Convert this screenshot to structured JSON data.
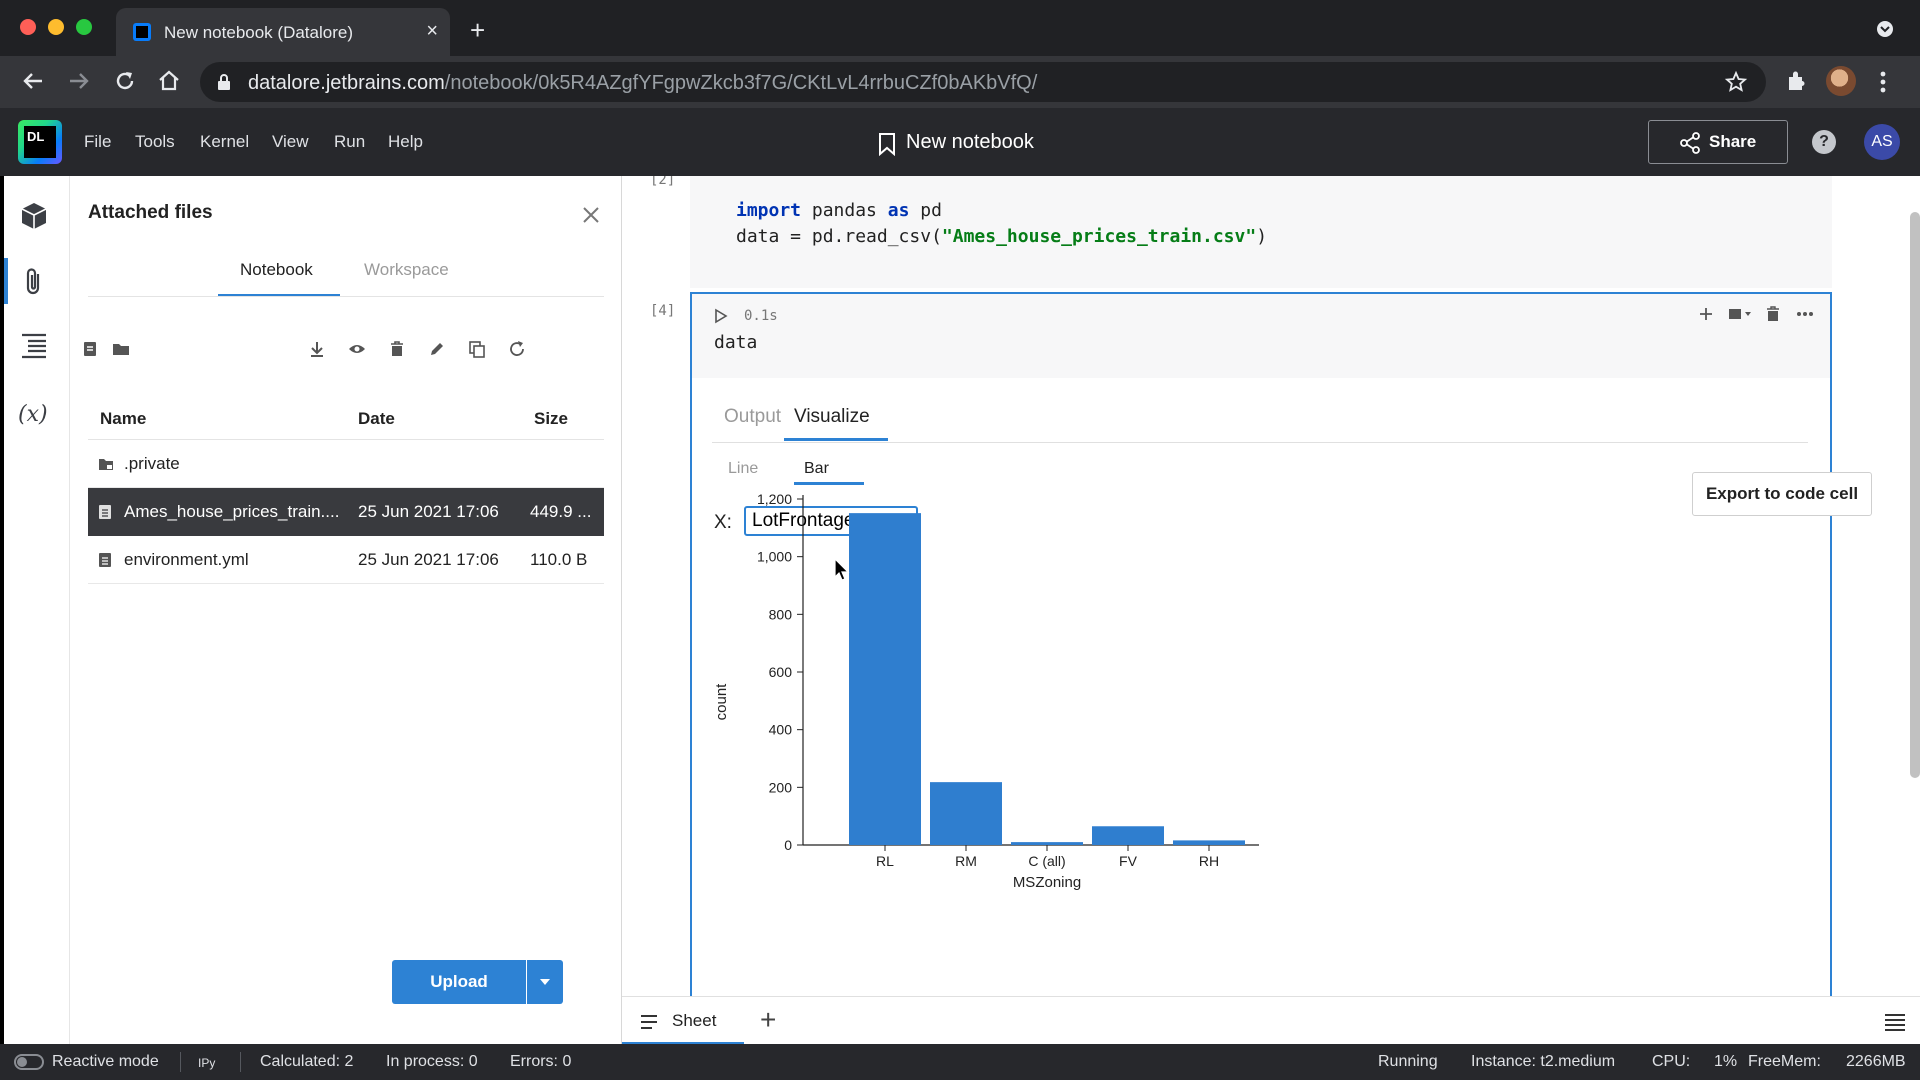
{
  "browser": {
    "tab_title": "New notebook (Datalore)",
    "url_host": "datalore.jetbrains.com",
    "url_path": "/notebook/0k5R4AZgfYFgpwZkcb3f7G/CKtLvL4rrbuCZf0bAKbVfQ/"
  },
  "app": {
    "logo_text": "DL",
    "menu": [
      "File",
      "Tools",
      "Kernel",
      "View",
      "Run",
      "Help"
    ],
    "notebook_title": "New notebook",
    "share_label": "Share",
    "help_label": "?",
    "user_initials": "AS"
  },
  "files_panel": {
    "title": "Attached files",
    "tabs": [
      "Notebook",
      "Workspace"
    ],
    "columns": [
      "Name",
      "Date",
      "Size"
    ],
    "rows": [
      {
        "name": ".private",
        "date": "",
        "size": "",
        "type": "folder"
      },
      {
        "name": "Ames_house_prices_train....",
        "date": "25 Jun 2021 17:06",
        "size": "449.9 ...",
        "type": "file",
        "selected": true
      },
      {
        "name": "environment.yml",
        "date": "25 Jun 2021 17:06",
        "size": "110.0 B",
        "type": "file"
      }
    ],
    "upload_label": "Upload"
  },
  "cells": [
    {
      "exec_count": "[2]",
      "code_line1_kw1": "import",
      "code_line1_mid": " pandas ",
      "code_line1_kw2": "as",
      "code_line1_end": " pd",
      "code_line2_start": "data = pd.read_csv(",
      "code_line2_str": "\"Ames_house_prices_train.csv\"",
      "code_line2_end": ")"
    },
    {
      "exec_count": "[4]",
      "exec_time": "0.1s",
      "code": "data"
    }
  ],
  "output": {
    "tabs": [
      "Output",
      "Visualize"
    ],
    "subtabs": [
      "Line",
      "Bar"
    ],
    "export_label": "Export to code cell",
    "x_label": "X:",
    "x_selected": "LotFrontage"
  },
  "chart_data": {
    "type": "bar",
    "categories": [
      "RL",
      "RM",
      "C (all)",
      "FV",
      "RH"
    ],
    "values": [
      1151,
      218,
      10,
      65,
      16
    ],
    "xlabel": "MSZoning",
    "ylabel": "count",
    "ylim": [
      0,
      1200
    ],
    "yticks": [
      0,
      200,
      400,
      600,
      800,
      1000,
      1200
    ],
    "ytick_labels": [
      "0",
      "200",
      "400",
      "600",
      "800",
      "1,000",
      "1,200"
    ],
    "bar_color": "#2f7ecf",
    "grid": false
  },
  "sheet": {
    "label": "Sheet"
  },
  "status": {
    "reactive_mode": "Reactive mode",
    "kernel": "IPy",
    "calculated": "Calculated: 2",
    "in_process": "In process: 0",
    "errors": "Errors: 0",
    "state": "Running",
    "instance": "Instance: t2.medium",
    "cpu_label": "CPU:",
    "cpu_value": "1%",
    "freemem_label": "FreeMem:",
    "freemem_value": "2266MB"
  },
  "colors": {
    "accent": "#2d82d4",
    "header_bg": "#27282c",
    "selected_row": "#393a3e"
  }
}
